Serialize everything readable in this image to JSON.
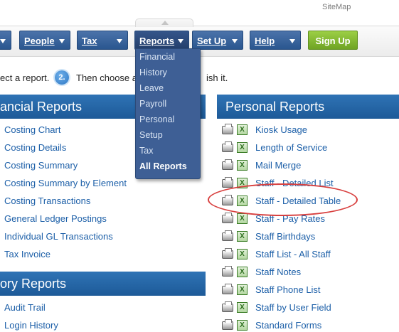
{
  "header": {
    "sitemap_label": "SiteMap"
  },
  "nav": {
    "people": "People",
    "tax": "Tax",
    "reports": "Reports",
    "setup": "Set Up",
    "help": "Help",
    "signup": "Sign Up"
  },
  "reports_menu": [
    "Financial",
    "History",
    "Leave",
    "Payroll",
    "Personal",
    "Setup",
    "Tax",
    "All Reports"
  ],
  "steps": {
    "step1_text": "ect a report.",
    "step2_number": "2.",
    "step2_text": "Then choose a",
    "step2_tail": "ish it."
  },
  "financial": {
    "title": "ancial Reports",
    "items": [
      "Costing Chart",
      "Costing Details",
      "Costing Summary",
      "Costing Summary by Element",
      "Costing Transactions",
      "General Ledger Postings",
      "Individual GL Transactions",
      "Tax Invoice"
    ]
  },
  "history": {
    "title": "ory Reports",
    "items": [
      "Audit Trail",
      "Login History"
    ]
  },
  "personal": {
    "title": "Personal Reports",
    "items": [
      "Kiosk Usage",
      "Length of Service",
      "Mail Merge",
      "Staff - Detailed List",
      "Staff - Detailed Table",
      "Staff - Pay Rates",
      "Staff Birthdays",
      "Staff List - All Staff",
      "Staff Notes",
      "Staff Phone List",
      "Staff by User Field",
      "Standard Forms"
    ]
  },
  "icons": {
    "printer": "printer-icon",
    "excel": "excel-icon",
    "excel_glyph": "X"
  },
  "colors": {
    "nav_blue": "#2a568f",
    "signup_green": "#7fb52c",
    "section_blue": "#1d5a98",
    "link_blue": "#1c5fa8",
    "annotation_red": "#d8403f"
  }
}
